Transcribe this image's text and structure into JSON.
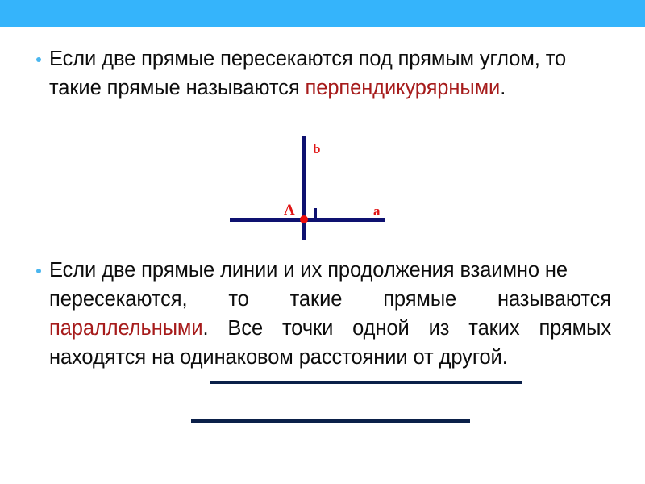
{
  "slide": {
    "background_color": "#ffffff",
    "accent_bar_color": "#35b4fb",
    "bullet_color": "#4ab6ef",
    "body_text_color": "#0d0d0d",
    "highlight_color": "#a61b1b",
    "figure_line_color": "#0e1170",
    "figure_point_color": "#ee0d0d",
    "figure_label_color": "#e01414",
    "parallel_line_color": "#0b2049"
  },
  "paragraph1": {
    "bullet": "bullet-dot",
    "line1": "Если две прямые пересекаются под прямым углом, то",
    "line2_prefix": "такие прямые называются ",
    "line2_highlight": "перпендикурярными",
    "line2_suffix": "."
  },
  "figure": {
    "label_vertical": "b",
    "label_point": "A",
    "label_horizontal": "a",
    "right_angle_marker": "right-angle-square"
  },
  "paragraph2": {
    "bullet": "bullet-dot",
    "line1": "Если две прямые линии и их продолжения взаимно не",
    "line2": "пересекаются, то такие прямые называются",
    "line3_highlight": "параллельными",
    "line3_rest": ". Все точки одной из таких прямых",
    "line4": "находятся на одинаковом расстоянии от другой."
  },
  "parallel_lines": {
    "line_top": "parallel-line-1",
    "line_bottom": "parallel-line-2"
  }
}
